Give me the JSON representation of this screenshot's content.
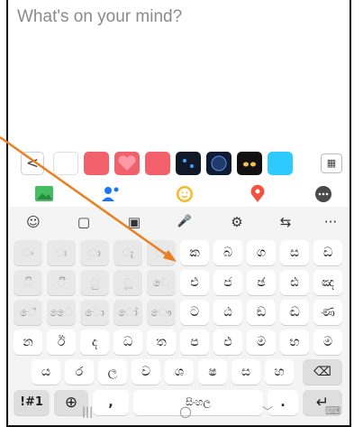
{
  "composer": {
    "placeholder": "What's on your mind?"
  },
  "backgrounds": {
    "back_glyph": "<",
    "swatches": [
      "#ffffff",
      "#f2606b",
      "#f2606b",
      "#f2606b",
      "#111827",
      "#1f3a6b",
      "#111111",
      "#2ec9ff"
    ],
    "grid_glyph": "▦"
  },
  "actions": {
    "photo_icon": "photo-icon",
    "tag_people_icon": "tag-people-icon",
    "feeling_icon": "feeling-icon",
    "checkin_icon": "checkin-icon",
    "more_icon": "more-icon"
  },
  "keyboard_toolbar": {
    "emoji": "☺",
    "clipboard": "▢",
    "sticker": "▣",
    "mic": "🎤",
    "settings": "⚙",
    "translate": "⇆",
    "more": "···"
  },
  "keyboard": {
    "row1": [
      "ං",
      "ඃ",
      "ා",
      "ැ",
      "ෑ",
      "ක",
      "බ",
      "ග",
      "ස",
      "ඩ"
    ],
    "row2": [
      "ි",
      "ී",
      "ු",
      "ූ",
      "ෙ",
      "එ",
      "ජ",
      "ඡ",
      "ඪ",
      "ඤ"
    ],
    "row3": [
      "ේ",
      "ෛ",
      "ො",
      "ෝ",
      "ෞ",
      "ට",
      "ඨ",
      "ඞ",
      "ඬ",
      "ණ"
    ],
    "row4": [
      "න",
      "ඊ",
      "ද",
      "ධ",
      "ත",
      "ප",
      "ඵ",
      "ම",
      "භ",
      "ම"
    ],
    "row5": [
      "ය",
      "ර",
      "ල",
      "ව",
      "ශ",
      "ෂ",
      "ස",
      "හ"
    ],
    "backspace": "⌫",
    "symbols": "!#1",
    "globe": "⊕",
    "comma": ",",
    "space": "සිංහල",
    "period": ".",
    "enter": "↵"
  },
  "nav": {
    "recents": "|||",
    "home": "○",
    "back": "﹀",
    "keyboard": "⌨"
  },
  "colors": {
    "arrow": "#ea7f1e",
    "accent_blue": "#1877f2",
    "key_bg": "#ffffff",
    "kbd_bg": "#f4f4f4"
  }
}
